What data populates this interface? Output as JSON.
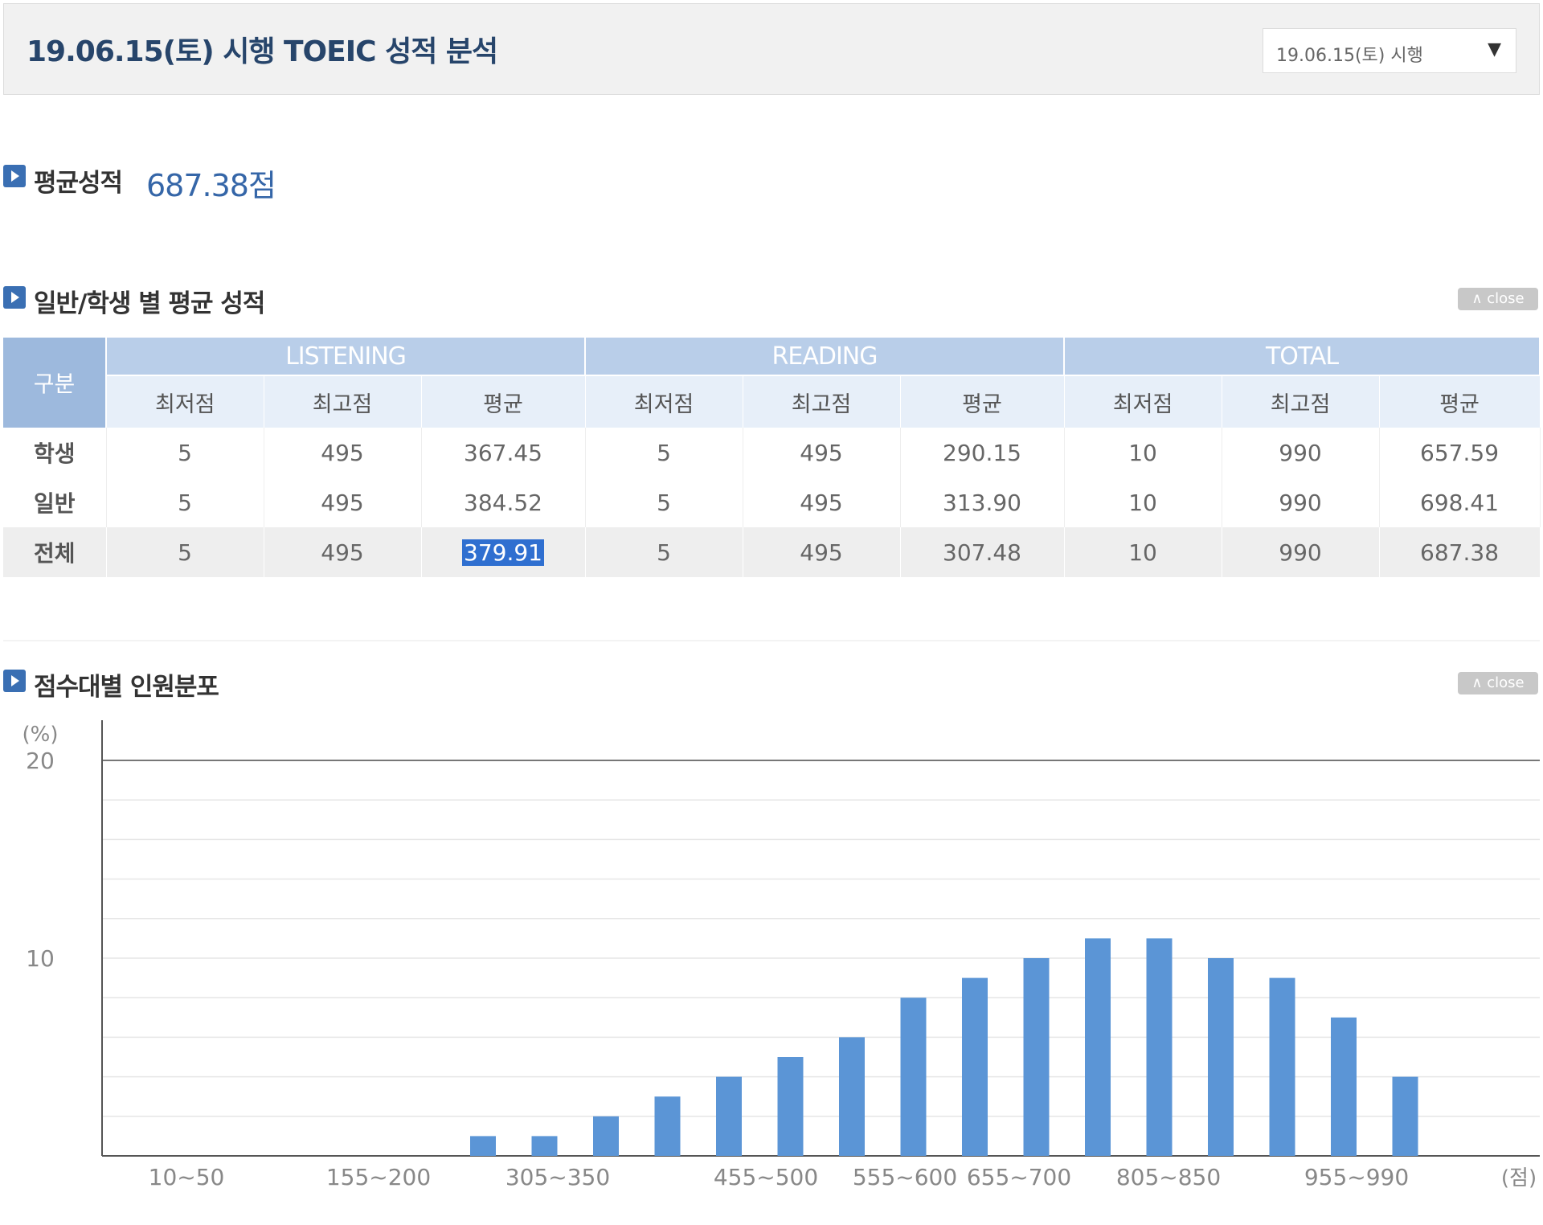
{
  "header": {
    "title": "19.06.15(토) 시행 TOEIC 성적 분석",
    "select_value": "19.06.15(토) 시행",
    "select_arrow": "▼"
  },
  "average": {
    "label": "평균성적",
    "value": "687.38점"
  },
  "table_section": {
    "title": "일반/학생 별 평균 성적",
    "close_label": "∧ close",
    "gubun": "구분",
    "groups": [
      "LISTENING",
      "READING",
      "TOTAL"
    ],
    "subheaders": [
      "최저점",
      "최고점",
      "평균",
      "최저점",
      "최고점",
      "평균",
      "최저점",
      "최고점",
      "평균"
    ],
    "rows": [
      {
        "label": "학생",
        "cells": [
          "5",
          "495",
          "367.45",
          "5",
          "495",
          "290.15",
          "10",
          "990",
          "657.59"
        ]
      },
      {
        "label": "일반",
        "cells": [
          "5",
          "495",
          "384.52",
          "5",
          "495",
          "313.90",
          "10",
          "990",
          "698.41"
        ]
      },
      {
        "label": "전체",
        "cells": [
          "5",
          "495",
          "379.91",
          "5",
          "495",
          "307.48",
          "10",
          "990",
          "687.38"
        ]
      }
    ]
  },
  "chart_section": {
    "title": "점수대별 인원분포",
    "close_label": "∧ close"
  },
  "chart_data": {
    "type": "bar",
    "y_unit_label": "(%)",
    "x_unit_label": "(점)",
    "ylim": [
      0,
      20
    ],
    "y_ticks": [
      10,
      20
    ],
    "grid": true,
    "bar_color": "#5b95d6",
    "x_tick_labels": [
      "10~50",
      "155~200",
      "305~350",
      "455~500",
      "555~600",
      "655~700",
      "805~850",
      "955~990"
    ],
    "bars": [
      {
        "value": 1
      },
      {
        "value": 1
      },
      {
        "value": 2
      },
      {
        "value": 3
      },
      {
        "value": 4
      },
      {
        "value": 5
      },
      {
        "value": 6
      },
      {
        "value": 8
      },
      {
        "value": 9
      },
      {
        "value": 10
      },
      {
        "value": 11
      },
      {
        "value": 11
      },
      {
        "value": 10
      },
      {
        "value": 9
      },
      {
        "value": 7
      },
      {
        "value": 4
      }
    ]
  }
}
